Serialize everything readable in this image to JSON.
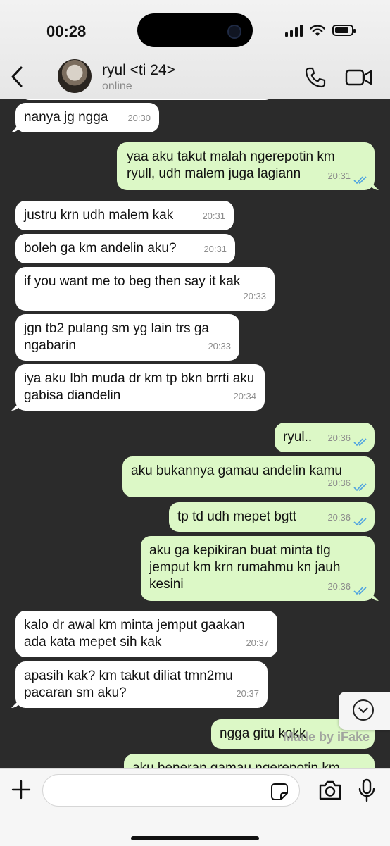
{
  "status_bar": {
    "time": "00:28",
    "battery_level": 0.85
  },
  "header": {
    "contact_name": "ryul <ti 24>",
    "contact_status": "online"
  },
  "messages": [
    {
      "dir": "in",
      "text": "nanya jg ngga",
      "time": "20:30"
    },
    {
      "dir": "out",
      "text": "yaa aku takut malah ngerepotin km ryull, udh malem juga lagiann",
      "time": "20:31"
    },
    {
      "dir": "in",
      "text": "justru krn udh malem kak",
      "time": "20:31"
    },
    {
      "dir": "in",
      "text": "boleh ga km andelin aku?",
      "time": "20:31"
    },
    {
      "dir": "in",
      "text": "if you want me to beg then say it kak",
      "time": "20:33"
    },
    {
      "dir": "in",
      "text": "jgn tb2 pulang sm yg lain trs ga ngabarin",
      "time": "20:33"
    },
    {
      "dir": "in",
      "text": "iya aku lbh muda dr km tp bkn brrti aku gabisa diandelin",
      "time": "20:34"
    },
    {
      "dir": "out",
      "text": "ryul..",
      "time": "20:36"
    },
    {
      "dir": "out",
      "text": "aku bukannya gamau andelin kamu",
      "time": "20:36"
    },
    {
      "dir": "out",
      "text": "tp td udh mepet bgtt",
      "time": "20:36"
    },
    {
      "dir": "out",
      "text": "aku ga kepikiran buat minta tlg jemput km krn rumahmu kn jauh kesini",
      "time": "20:36"
    },
    {
      "dir": "in",
      "text": "kalo dr awal km minta jemput gaakan ada kata mepet sih kak",
      "time": "20:37"
    },
    {
      "dir": "in",
      "text": "apasih kak? km takut diliat tmn2mu pacaran sm aku?",
      "time": "20:37"
    },
    {
      "dir": "out",
      "text": "ngga gitu kokk",
      "time": ""
    },
    {
      "dir": "out",
      "text": "aku beneran gamau ngerepotin km",
      "time": ""
    }
  ],
  "watermark": "Made by iFake",
  "colors": {
    "bubble_out": "#dcf8c6",
    "bubble_in": "#ffffff",
    "chat_bg": "#2b2b2b",
    "tick_blue": "#4fa3e0"
  }
}
